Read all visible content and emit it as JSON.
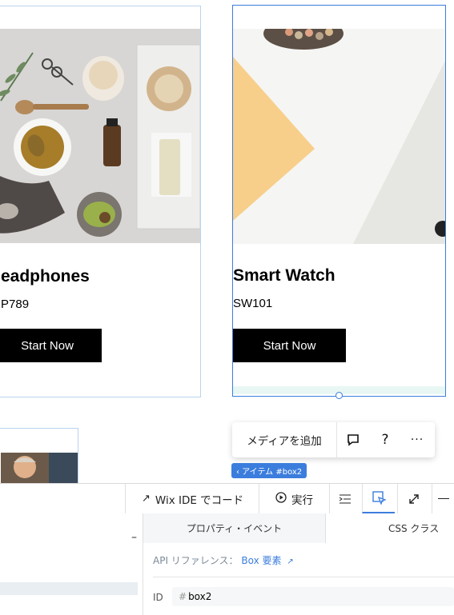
{
  "products": [
    {
      "name": "eadphones",
      "code": "P789",
      "button": "Start Now"
    },
    {
      "name": "Smart Watch",
      "code": "SW101",
      "button": "Start Now"
    }
  ],
  "float_toolbar": {
    "media_label": "メディアを追加",
    "comment_icon": "comment-icon",
    "help_label": "?",
    "more_label": "···"
  },
  "selection_tag": "‹ アイテム #box2",
  "ide_toolbar": {
    "code_label": "Wix IDE でコード",
    "run_label": "実行"
  },
  "panel": {
    "tabs": [
      "プロパティ・イベント",
      "CSS クラス"
    ],
    "api_label": "API リファレンス：",
    "api_link": "Box 要素",
    "id_label": "ID",
    "id_value": "box2",
    "collapse": "–"
  },
  "colors": {
    "accent": "#3b7ddd",
    "button_bg": "#000000"
  }
}
